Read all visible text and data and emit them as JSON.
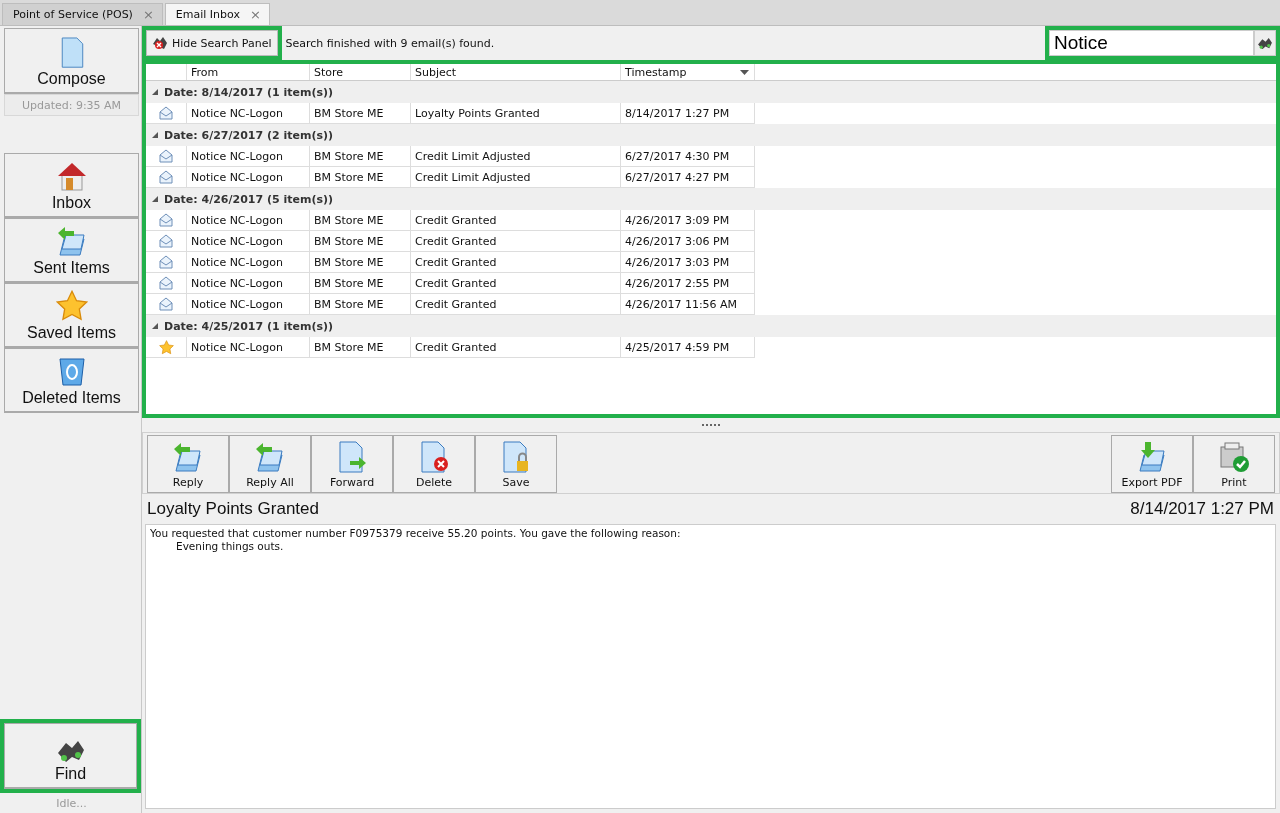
{
  "tabs": [
    {
      "label": "Point of Service (POS)",
      "selected": false,
      "close": "×"
    },
    {
      "label": "Email Inbox",
      "selected": true,
      "close": "×"
    }
  ],
  "sidebar": {
    "compose": {
      "label": "Compose",
      "kind": "page"
    },
    "updated": "Updated: 9:35 AM",
    "folders": [
      {
        "label": "Inbox",
        "kind": "house"
      },
      {
        "label": "Sent Items",
        "kind": "sent"
      },
      {
        "label": "Saved Items",
        "kind": "star"
      },
      {
        "label": "Deleted Items",
        "kind": "bin"
      }
    ],
    "find": {
      "label": "Find",
      "kind": "binoculars",
      "highlighted": true
    },
    "status": "Idle..."
  },
  "search_bar": {
    "hide_button": {
      "label": "Hide Search Panel",
      "highlighted": true
    },
    "message": "Search finished with 9 email(s) found.",
    "search_field": {
      "value": "Notice",
      "highlighted": true
    }
  },
  "results": {
    "highlighted": true,
    "columns": [
      {
        "label": "From",
        "sorted": false
      },
      {
        "label": "Store",
        "sorted": false
      },
      {
        "label": "Subject",
        "sorted": false
      },
      {
        "label": "Timestamp",
        "sorted": true
      }
    ],
    "groups": [
      {
        "header": "Date: 8/14/2017 (1 item(s))",
        "rows": [
          {
            "kind": "envelope",
            "from": "Notice NC-Logon",
            "store": "BM Store ME",
            "subject": "Loyalty Points Granted",
            "timestamp": "8/14/2017 1:27 PM"
          }
        ]
      },
      {
        "header": "Date: 6/27/2017 (2 item(s))",
        "rows": [
          {
            "kind": "envelope",
            "from": "Notice NC-Logon",
            "store": "BM Store ME",
            "subject": "Credit Limit Adjusted",
            "timestamp": "6/27/2017 4:30 PM"
          },
          {
            "kind": "envelope",
            "from": "Notice NC-Logon",
            "store": "BM Store ME",
            "subject": "Credit Limit Adjusted",
            "timestamp": "6/27/2017 4:27 PM"
          }
        ]
      },
      {
        "header": "Date: 4/26/2017 (5 item(s))",
        "rows": [
          {
            "kind": "envelope",
            "from": "Notice NC-Logon",
            "store": "BM Store ME",
            "subject": "Credit Granted",
            "timestamp": "4/26/2017 3:09 PM"
          },
          {
            "kind": "envelope",
            "from": "Notice NC-Logon",
            "store": "BM Store ME",
            "subject": "Credit Granted",
            "timestamp": "4/26/2017 3:06 PM"
          },
          {
            "kind": "envelope",
            "from": "Notice NC-Logon",
            "store": "BM Store ME",
            "subject": "Credit Granted",
            "timestamp": "4/26/2017 3:03 PM"
          },
          {
            "kind": "envelope",
            "from": "Notice NC-Logon",
            "store": "BM Store ME",
            "subject": "Credit Granted",
            "timestamp": "4/26/2017 2:55 PM"
          },
          {
            "kind": "envelope",
            "from": "Notice NC-Logon",
            "store": "BM Store ME",
            "subject": "Credit Granted",
            "timestamp": "4/26/2017 11:56 AM"
          }
        ]
      },
      {
        "header": "Date: 4/25/2017 (1 item(s))",
        "rows": [
          {
            "kind": "star",
            "from": "Notice NC-Logon",
            "store": "BM Store ME",
            "subject": "Credit Granted",
            "timestamp": "4/25/2017 4:59 PM"
          }
        ]
      }
    ]
  },
  "actions": {
    "left": [
      {
        "label": "Reply",
        "kind": "reply"
      },
      {
        "label": "Reply All",
        "kind": "reply"
      },
      {
        "label": "Forward",
        "kind": "forward"
      },
      {
        "label": "Delete",
        "kind": "delete"
      },
      {
        "label": "Save",
        "kind": "lock"
      }
    ],
    "right": [
      {
        "label": "Export PDF",
        "kind": "export"
      },
      {
        "label": "Print",
        "kind": "printer"
      }
    ]
  },
  "preview": {
    "subject": "Loyalty Points Granted",
    "timestamp": "8/14/2017 1:27 PM",
    "body": [
      {
        "text": "You requested that customer number F0975379 receive 55.20 points.  You gave the following reason:",
        "indented": false
      },
      {
        "text": "Evening things outs.",
        "indented": true
      }
    ]
  }
}
